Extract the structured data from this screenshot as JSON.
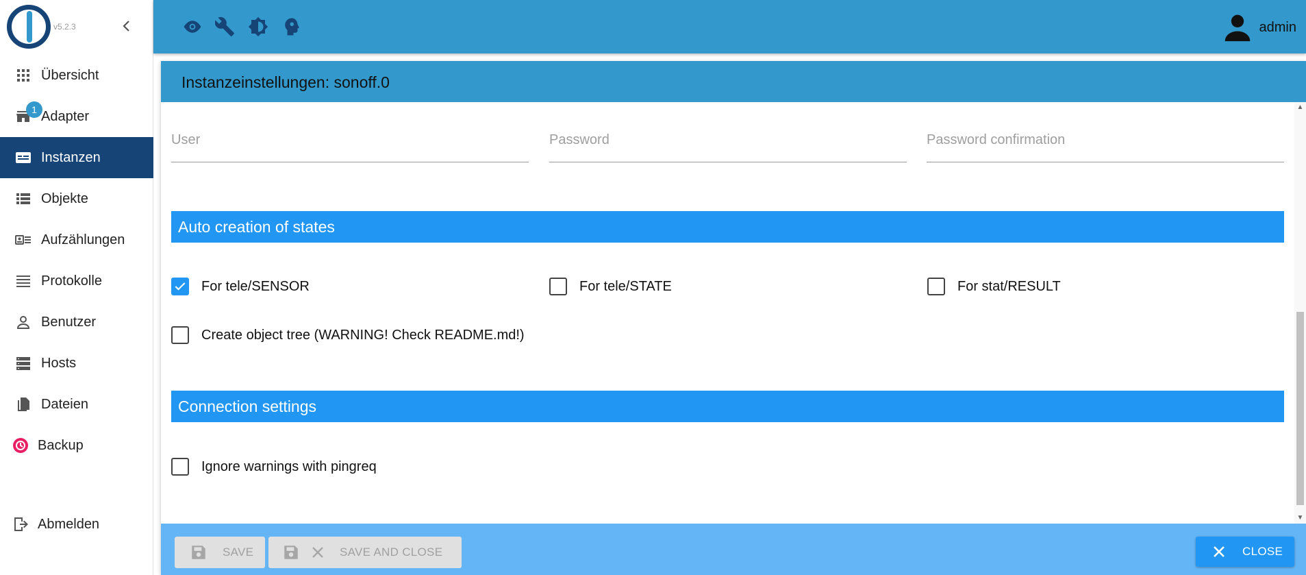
{
  "app": {
    "version": "v5.2.3"
  },
  "sidebar": {
    "items": [
      {
        "label": "Übersicht",
        "icon": "grid-icon"
      },
      {
        "label": "Adapter",
        "icon": "store-icon",
        "badge": "1"
      },
      {
        "label": "Instanzen",
        "icon": "instances-icon",
        "active": true
      },
      {
        "label": "Objekte",
        "icon": "list-icon"
      },
      {
        "label": "Aufzählungen",
        "icon": "enum-icon"
      },
      {
        "label": "Protokolle",
        "icon": "log-icon"
      },
      {
        "label": "Benutzer",
        "icon": "user-icon"
      },
      {
        "label": "Hosts",
        "icon": "hosts-icon"
      },
      {
        "label": "Dateien",
        "icon": "files-icon"
      },
      {
        "label": "Backup",
        "icon": "backup-icon"
      }
    ],
    "logout": {
      "label": "Abmelden",
      "icon": "logout-icon"
    }
  },
  "topbar": {
    "icons": [
      "eye-icon",
      "wrench-icon",
      "brightness-icon",
      "expert-mode-icon"
    ],
    "user": "admin"
  },
  "panel": {
    "title": "Instanzeinstellungen: sonoff.0",
    "fields": {
      "user_placeholder": "User",
      "password_placeholder": "Password",
      "password_confirm_placeholder": "Password confirmation"
    },
    "section_auto": "Auto creation of states",
    "checkboxes": {
      "tele_sensor": {
        "label": "For tele/SENSOR",
        "checked": true
      },
      "tele_state": {
        "label": "For tele/STATE",
        "checked": false
      },
      "stat_result": {
        "label": "For stat/RESULT",
        "checked": false
      },
      "object_tree": {
        "label": "Create object tree (WARNING! Check README.md!)",
        "checked": false
      },
      "ignore_pingreq": {
        "label": "Ignore warnings with pingreq",
        "checked": false
      }
    },
    "section_connection": "Connection settings"
  },
  "footer": {
    "save": "SAVE",
    "save_close": "SAVE AND CLOSE",
    "close": "CLOSE"
  },
  "colors": {
    "primary": "#3399cc",
    "dark": "#164477",
    "accent": "#2196f3",
    "footer": "#64b5f6"
  }
}
